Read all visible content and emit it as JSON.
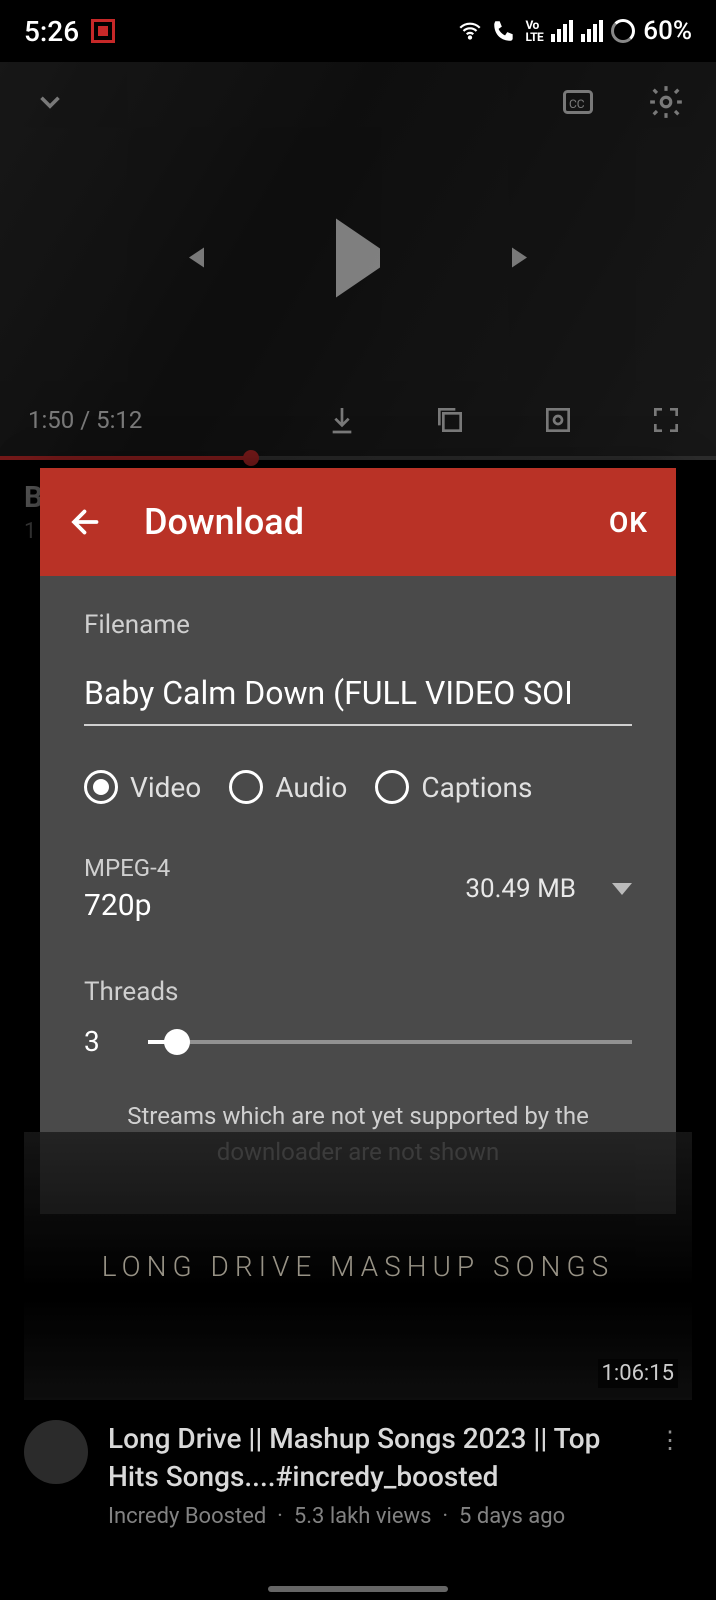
{
  "statusbar": {
    "time": "5:26",
    "volte": "Vo\nLTE",
    "battery": "60%"
  },
  "player": {
    "time_current": "1:50",
    "time_sep": " / ",
    "time_total": "5:12"
  },
  "behind": {
    "title_initial": "B",
    "views_initial": "1"
  },
  "dialog": {
    "title": "Download",
    "ok": "OK",
    "filename_label": "Filename",
    "filename_value": "Baby Calm Down (FULL VIDEO SOI",
    "types": {
      "video": "Video",
      "audio": "Audio",
      "captions": "Captions",
      "selected": "video"
    },
    "format": {
      "codec": "MPEG-4",
      "resolution": "720p",
      "size": "30.49 MB"
    },
    "threads_label": "Threads",
    "threads_value": "3",
    "hint": "Streams which are not yet supported by the downloader are not shown"
  },
  "related": {
    "thumb_text": "LONG DRIVE MASHUP SONGS",
    "thumb_duration": "1:06:15",
    "title": "Long Drive || Mashup Songs 2023 || Top Hits Songs....#incredy_boosted",
    "channel": "Incredy Boosted",
    "views": "5.3 lakh views",
    "age": "5 days ago"
  }
}
